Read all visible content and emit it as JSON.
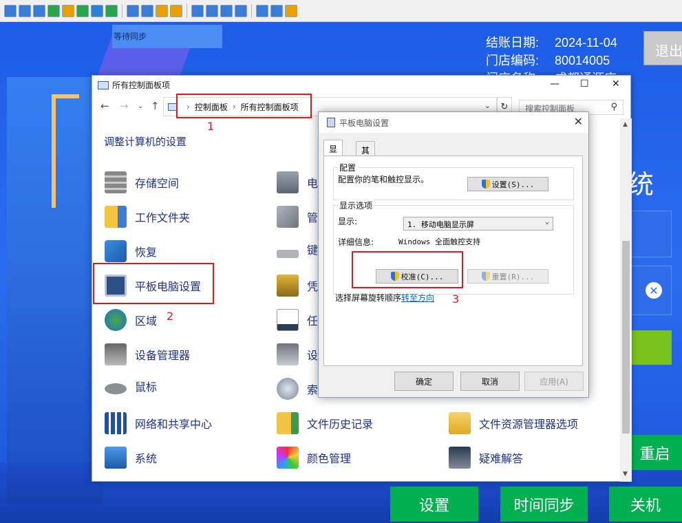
{
  "toolbar": {
    "icons": [
      {
        "name": "screen-icon",
        "color": "#3a7bd5"
      },
      {
        "name": "monitor-icon",
        "color": "#3a7bd5"
      },
      {
        "name": "terminal-icon",
        "color": "#3a7bd5"
      },
      {
        "name": "transfer-icon",
        "color": "#2aa34a"
      },
      {
        "name": "power-icon",
        "color": "#e8a100"
      },
      {
        "name": "chat-icon",
        "color": "#2aa34a"
      },
      {
        "name": "phone-icon",
        "color": "#2f7fd6"
      },
      {
        "name": "message-icon",
        "color": "#2aa34a"
      },
      {
        "name": "upload-icon",
        "color": "#3a7bd5"
      },
      {
        "name": "network-icon",
        "color": "#3a7bd5"
      },
      {
        "name": "lock-icon",
        "color": "#e8a100"
      },
      {
        "name": "unlock-icon",
        "color": "#e8a100"
      },
      {
        "name": "window-icon",
        "color": "#3a7bd5"
      },
      {
        "name": "fullscreen-icon",
        "color": "#3a7bd5"
      },
      {
        "name": "square-icon",
        "color": "#3a7bd5"
      },
      {
        "name": "fit-icon",
        "color": "#3a7bd5"
      },
      {
        "name": "copy-icon",
        "color": "#3a7bd5"
      },
      {
        "name": "tools-icon",
        "color": "#3a7bd5"
      },
      {
        "name": "close-session-icon",
        "color": "#e8a100"
      }
    ]
  },
  "app": {
    "sync_status": "等待同步",
    "info": [
      {
        "label": "结账日期:",
        "value": "2024-11-04"
      },
      {
        "label": "门店编码:",
        "value": "80014005"
      },
      {
        "label": "门店名称:",
        "value": "成都通源店"
      }
    ],
    "logout_label": "退出",
    "right_title": "统",
    "buttons": {
      "restart": "重启",
      "settings": "设置",
      "time_sync": "时间同步",
      "shutdown": "关机"
    },
    "colors": {
      "background": "#2a6cf0",
      "green": "#00b050"
    }
  },
  "control_panel": {
    "title": "所有控制面板项",
    "breadcrumb": [
      "控制面板",
      "所有控制面板项"
    ],
    "search_placeholder": "搜索控制面板",
    "heading": "调整计算机的设置",
    "items_col1": [
      {
        "label": "存储空间",
        "icon": "storage-icon"
      },
      {
        "label": "工作文件夹",
        "icon": "work-folder-icon"
      },
      {
        "label": "恢复",
        "icon": "recovery-icon"
      },
      {
        "label": "平板电脑设置",
        "icon": "tablet-icon"
      },
      {
        "label": "区域",
        "icon": "region-globe-icon"
      },
      {
        "label": "设备管理器",
        "icon": "device-manager-icon"
      },
      {
        "label": "鼠标",
        "icon": "mouse-icon"
      },
      {
        "label": "网络和共享中心",
        "icon": "network-center-icon"
      },
      {
        "label": "系统",
        "icon": "system-icon"
      }
    ],
    "items_col2": [
      {
        "label": "电",
        "icon": "phone-modem-icon"
      },
      {
        "label": "管",
        "icon": "admin-tools-icon"
      },
      {
        "label": "键",
        "icon": "keyboard-icon"
      },
      {
        "label": "凭",
        "icon": "credential-icon"
      },
      {
        "label": "任",
        "icon": "taskbar-icon"
      },
      {
        "label": "设",
        "icon": "devices-printers-icon"
      },
      {
        "label": "索",
        "icon": "indexing-icon"
      },
      {
        "label": "文件历史记录",
        "icon": "file-history-icon"
      },
      {
        "label": "颜色管理",
        "icon": "color-management-icon"
      }
    ],
    "items_col3": [
      {
        "label": "文件资源管理器选项",
        "icon": "explorer-options-icon"
      },
      {
        "label": "疑难解答",
        "icon": "troubleshoot-icon"
      }
    ],
    "annotations": {
      "one": "1",
      "two": "2",
      "three": "3"
    }
  },
  "tablet_dialog": {
    "title": "平板电脑设置",
    "tabs": [
      "显示",
      "其他"
    ],
    "config_group": "配置",
    "config_text": "配置你的笔和触控显示。",
    "setup_button": "设置(S)...",
    "display_group": "显示选项",
    "display_label": "显示:",
    "display_value": "1. 移动电脑显示屏",
    "details_label": "详细信息:",
    "details_value": "Windows 全面触控支持",
    "calibrate_button": "校准(C)...",
    "reset_button": "重置(R)...",
    "rotation_text": "选择屏幕旋转顺序",
    "rotation_link": "转至方向",
    "ok": "确定",
    "cancel": "取消",
    "apply": "应用(A)"
  }
}
